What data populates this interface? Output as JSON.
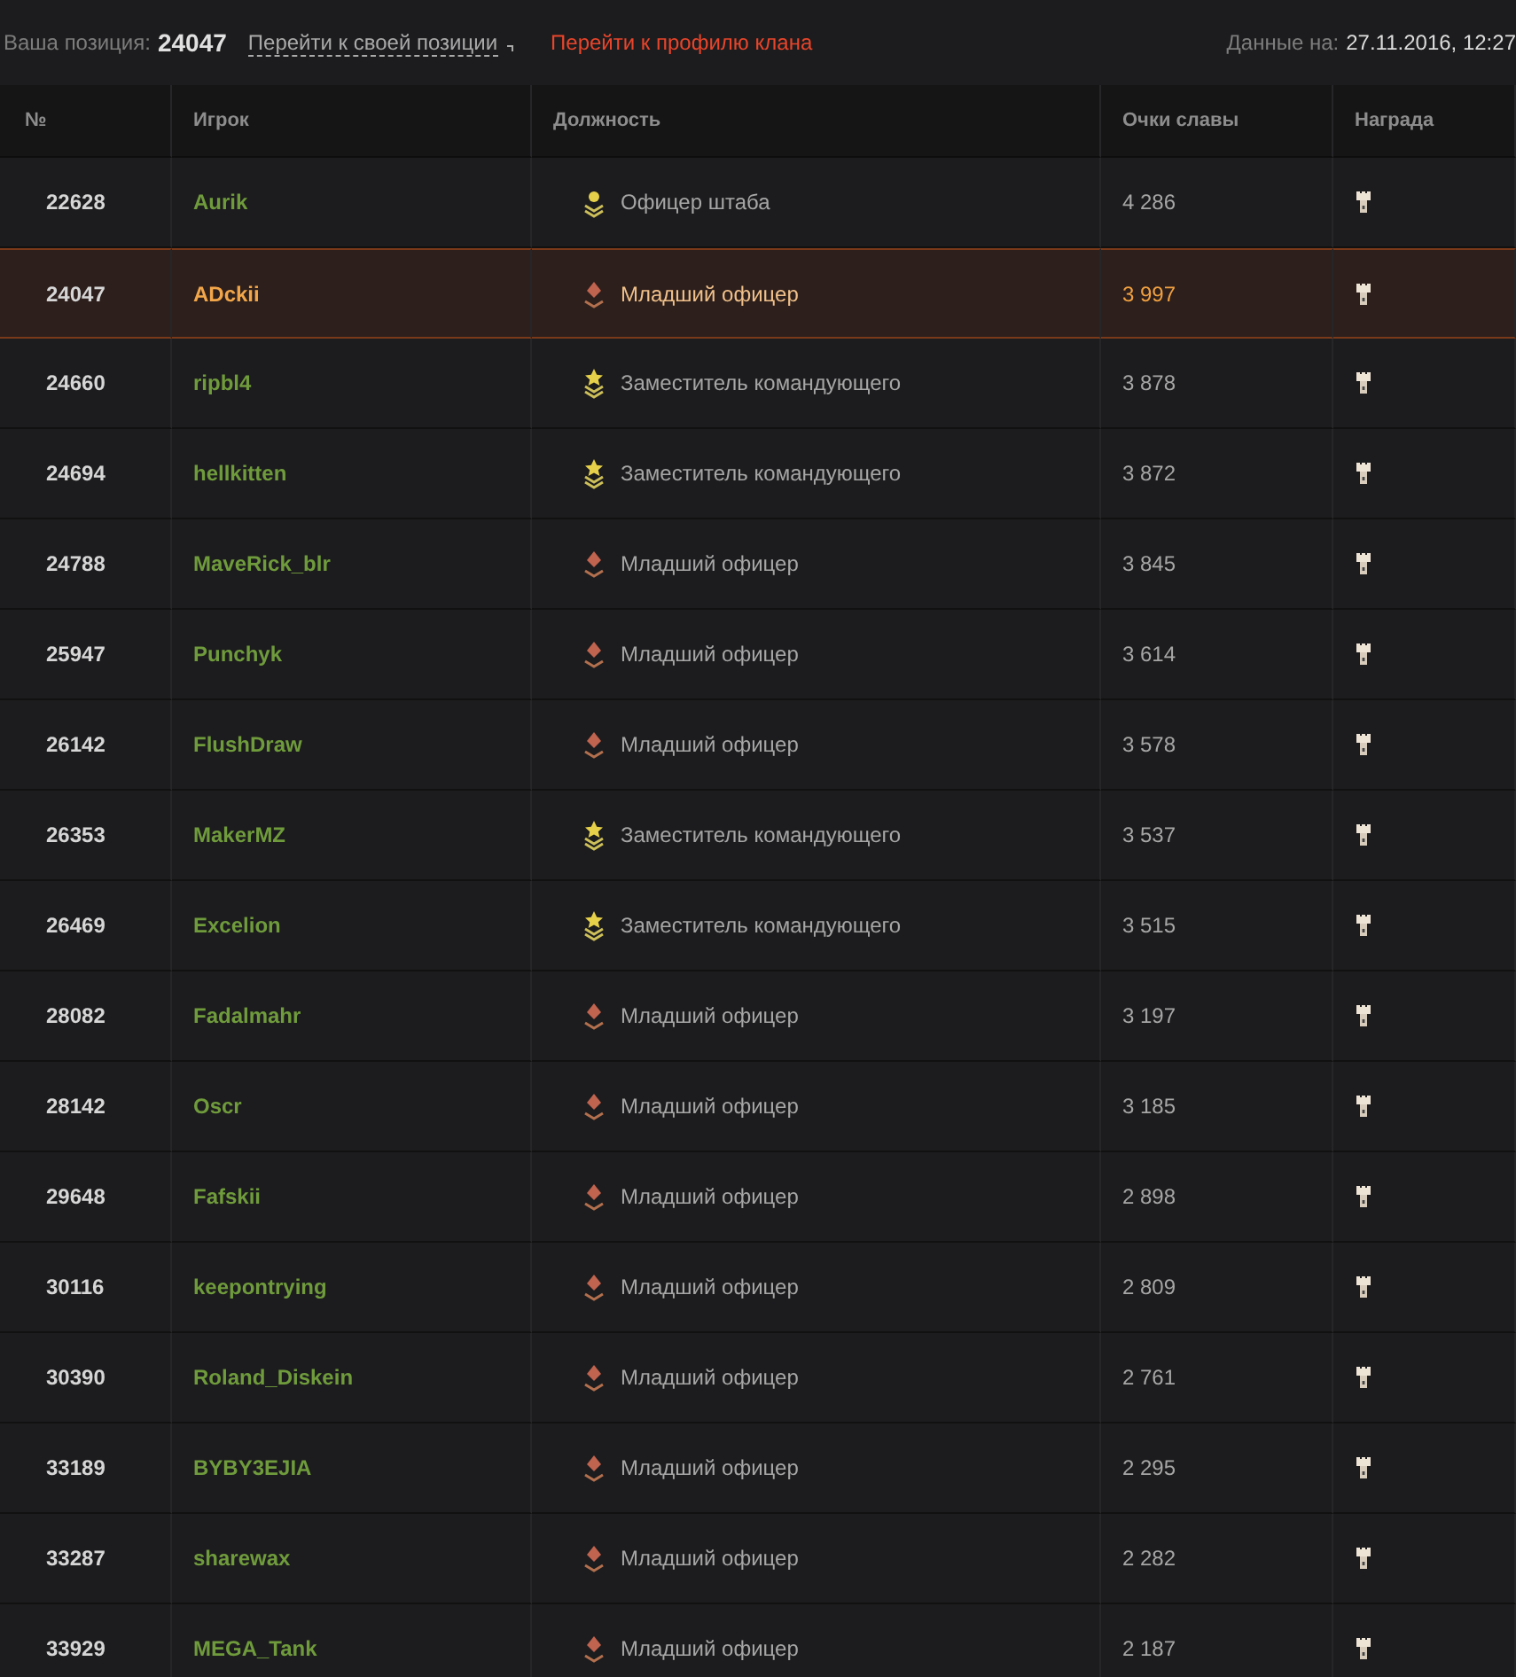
{
  "header": {
    "position_label": "Ваша позиция:",
    "position_value": "24047",
    "goto_position": "Перейти к своей позиции",
    "goto_clan": "Перейти к профилю клана",
    "date_label": "Данные на:",
    "date_value": "27.11.2016, 12:27"
  },
  "table": {
    "columns": [
      "№",
      "Игрок",
      "Должность",
      "Очки славы",
      "Награда"
    ],
    "rows": [
      {
        "rank": "22628",
        "player": "Aurik",
        "role": "Офицер штаба",
        "kind": "staff",
        "points": "4 286",
        "selected": false
      },
      {
        "rank": "24047",
        "player": "ADckii",
        "role": "Младший офицер",
        "kind": "junior",
        "points": "3 997",
        "selected": true
      },
      {
        "rank": "24660",
        "player": "ripbl4",
        "role": "Заместитель командующего",
        "kind": "deputy",
        "points": "3 878",
        "selected": false
      },
      {
        "rank": "24694",
        "player": "hellkitten",
        "role": "Заместитель командующего",
        "kind": "deputy",
        "points": "3 872",
        "selected": false
      },
      {
        "rank": "24788",
        "player": "MaveRick_blr",
        "role": "Младший офицер",
        "kind": "junior",
        "points": "3 845",
        "selected": false
      },
      {
        "rank": "25947",
        "player": "Punchyk",
        "role": "Младший офицер",
        "kind": "junior",
        "points": "3 614",
        "selected": false
      },
      {
        "rank": "26142",
        "player": "FlushDraw",
        "role": "Младший офицер",
        "kind": "junior",
        "points": "3 578",
        "selected": false
      },
      {
        "rank": "26353",
        "player": "MakerMZ",
        "role": "Заместитель командующего",
        "kind": "deputy",
        "points": "3 537",
        "selected": false
      },
      {
        "rank": "26469",
        "player": "Excelion",
        "role": "Заместитель командующего",
        "kind": "deputy",
        "points": "3 515",
        "selected": false
      },
      {
        "rank": "28082",
        "player": "Fadalmahr",
        "role": "Младший офицер",
        "kind": "junior",
        "points": "3 197",
        "selected": false
      },
      {
        "rank": "28142",
        "player": "Oscr",
        "role": "Младший офицер",
        "kind": "junior",
        "points": "3 185",
        "selected": false
      },
      {
        "rank": "29648",
        "player": "Fafskii",
        "role": "Младший офицер",
        "kind": "junior",
        "points": "2 898",
        "selected": false
      },
      {
        "rank": "30116",
        "player": "keepontrying",
        "role": "Младший офицер",
        "kind": "junior",
        "points": "2 809",
        "selected": false
      },
      {
        "rank": "30390",
        "player": "Roland_Diskein",
        "role": "Младший офицер",
        "kind": "junior",
        "points": "2 761",
        "selected": false
      },
      {
        "rank": "33189",
        "player": "BYBY3EJIA",
        "role": "Младший офицер",
        "kind": "junior",
        "points": "2 295",
        "selected": false
      },
      {
        "rank": "33287",
        "player": "sharewax",
        "role": "Младший офицер",
        "kind": "junior",
        "points": "2 282",
        "selected": false
      },
      {
        "rank": "33929",
        "player": "MEGA_Tank",
        "role": "Младший офицер",
        "kind": "junior",
        "points": "2 187",
        "selected": false
      }
    ]
  }
}
